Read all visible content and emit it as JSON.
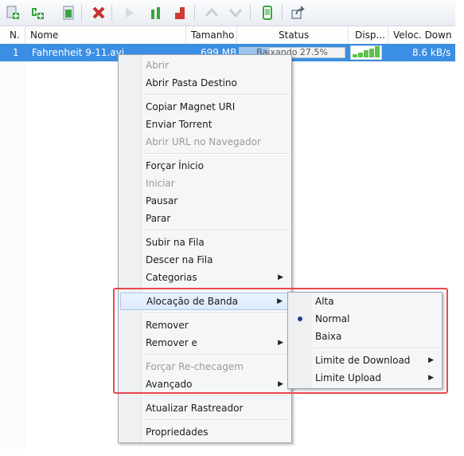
{
  "toolbar": {
    "buttons": [
      {
        "icon": "add-torrent-icon",
        "enabled": true
      },
      {
        "icon": "add-magnet-icon",
        "enabled": true
      },
      {
        "icon": "create-torrent-icon",
        "enabled": true
      },
      {
        "icon": "remove-icon",
        "enabled": true
      },
      {
        "icon": "start-icon",
        "enabled": false
      },
      {
        "icon": "pause-icon",
        "enabled": true
      },
      {
        "icon": "stop-icon",
        "enabled": true
      },
      {
        "icon": "move-up-icon",
        "enabled": false
      },
      {
        "icon": "move-down-icon",
        "enabled": false
      },
      {
        "icon": "remote-icon",
        "enabled": true
      },
      {
        "icon": "share-icon",
        "enabled": true
      }
    ]
  },
  "list": {
    "columns": [
      "N.",
      "Nome",
      "Tamanho",
      "Status",
      "Disp...",
      "Veloc. Down"
    ],
    "rows": [
      {
        "number": "1",
        "name": "Fahrenheit 9-11.avi",
        "size": "699 MB",
        "status": "Baixando 27.5%",
        "progress": 0.275,
        "availability_bars": 5,
        "down_speed": "8.6 kB/s",
        "selected": true
      }
    ]
  },
  "context_menu": {
    "items": [
      {
        "label": "Abrir",
        "disabled": true
      },
      {
        "label": "Abrir Pasta Destino"
      },
      {
        "separator": true
      },
      {
        "label": "Copiar Magnet URI"
      },
      {
        "label": "Enviar Torrent"
      },
      {
        "label": "Abrir URL no Navegador",
        "disabled": true
      },
      {
        "separator": true
      },
      {
        "label": "Forçar Ínicio"
      },
      {
        "label": "Iniciar",
        "disabled": true
      },
      {
        "label": "Pausar"
      },
      {
        "label": "Parar"
      },
      {
        "separator": true
      },
      {
        "label": "Subir na Fila"
      },
      {
        "label": "Descer na Fila"
      },
      {
        "label": "Categorias",
        "submenu": true
      },
      {
        "separator": true
      },
      {
        "label": "Alocação de Banda",
        "submenu": true,
        "hover": true
      },
      {
        "separator": true
      },
      {
        "label": "Remover"
      },
      {
        "label": "Remover e",
        "submenu": true
      },
      {
        "separator": true
      },
      {
        "label": "Forçar Re-checagem",
        "disabled": true
      },
      {
        "label": "Avançado",
        "submenu": true
      },
      {
        "separator": true
      },
      {
        "label": "Atualizar Rastreador"
      },
      {
        "separator": true
      },
      {
        "label": "Propriedades"
      }
    ]
  },
  "bandwidth_submenu": {
    "items": [
      {
        "label": "Alta"
      },
      {
        "label": "Normal",
        "checked": true
      },
      {
        "label": "Baixa"
      },
      {
        "separator": true
      },
      {
        "label": "Limite de Download",
        "submenu": true
      },
      {
        "label": "Limite Upload",
        "submenu": true
      }
    ]
  },
  "colors": {
    "selection": "#3a8ee3",
    "highlight_border": "#e8484e",
    "availability": "#5fc14d"
  }
}
